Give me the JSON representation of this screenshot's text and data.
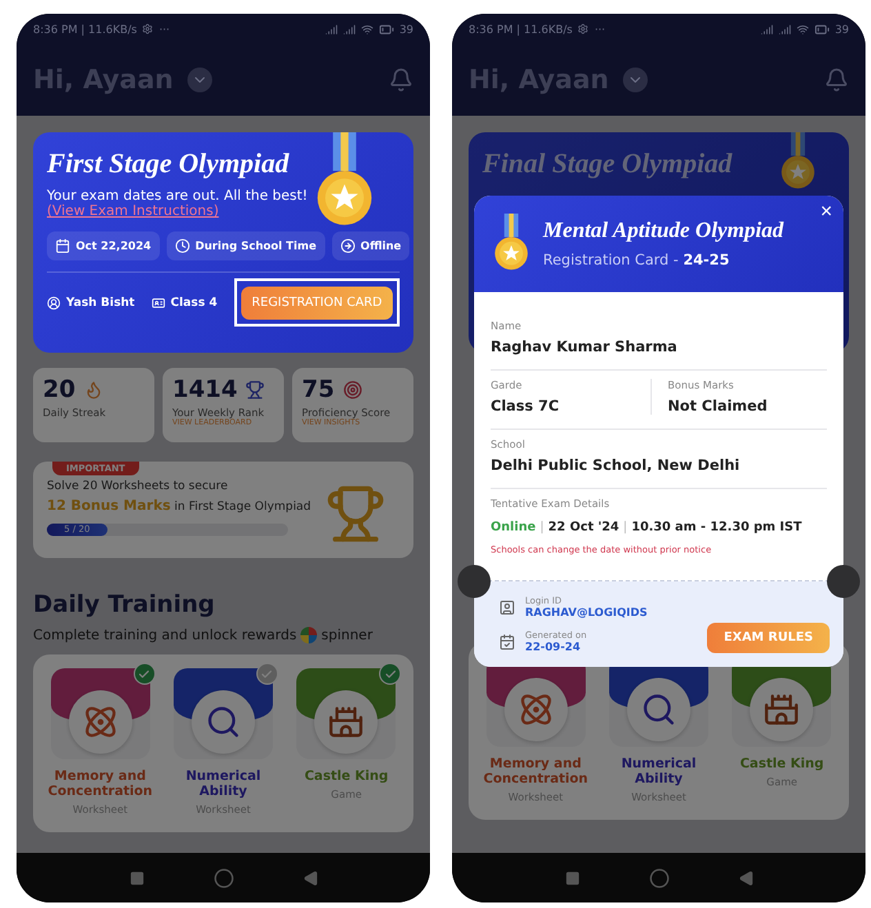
{
  "home_screen": {
    "status_bar": {
      "time": "8:36 PM | 11.6KB/s",
      "more": "···",
      "battery": "39"
    },
    "greeting": "Hi, Ayaan",
    "olympiad_card": {
      "title": "First Stage Olympiad",
      "message": "Your exam dates are out. All the best!",
      "link": "(View Exam Instructions)",
      "chips": [
        {
          "kind": "date",
          "label": "Oct 22,2024"
        },
        {
          "kind": "time",
          "label": "During School Time"
        },
        {
          "kind": "mode",
          "label": "Offline"
        }
      ],
      "student": "Yash Bisht",
      "class": "Class 4",
      "button": "REGISTRATION CARD",
      "highlighted": true
    },
    "stats": [
      {
        "kind": "streak",
        "value": "20",
        "label": "Daily Streak"
      },
      {
        "kind": "rank",
        "value": "1414",
        "label": "Your Weekly Rank",
        "link": "VIEW LEADERBOARD"
      },
      {
        "kind": "score",
        "value": "75",
        "label": "Proficiency Score",
        "link": "VIEW INSIGHTS"
      }
    ],
    "important": {
      "badge": "IMPORTANT",
      "line": "Solve 20 Worksheets to secure",
      "bonus": "12 Bonus Marks",
      "line_end": "in First Stage Olympiad",
      "level": 0.25,
      "progress": "5 / 20"
    },
    "daily_training": {
      "title": "Daily Training",
      "subtitle": "Complete training and unlock rewards",
      "reward": "spinner",
      "items": [
        {
          "kind": "atom",
          "title": "Memory and Concentration",
          "type": "Worksheet",
          "checked": true
        },
        {
          "kind": "chart",
          "title": "Numerical Ability",
          "type": "Worksheet",
          "checked": false
        },
        {
          "kind": "castle",
          "title": "Castle King",
          "type": "Game",
          "checked": true
        }
      ]
    }
  },
  "registration_screen": {
    "status_bar": {
      "time": "8:36 PM | 11.6KB/s",
      "more": "···",
      "battery": "39"
    },
    "greeting": "Hi, Ayaan",
    "background_card": {
      "title": "Final Stage Olympiad"
    },
    "training_items": [
      {
        "kind": "atom",
        "title": "Memory and Concentration",
        "type": "Worksheet"
      },
      {
        "kind": "chart",
        "title": "Numerical Ability",
        "type": "Worksheet"
      },
      {
        "kind": "castle",
        "title": "Castle King",
        "type": "Game"
      }
    ],
    "dialog": {
      "title": "Mental Aptitude Olympiad",
      "subtitle": "Registration Card - **24-25**",
      "close": "×",
      "name": {
        "label": "Name",
        "value": "Raghav Kumar Sharma"
      },
      "grade": {
        "label": "Garde",
        "value": "Class 7C"
      },
      "bonus": {
        "label": "Bonus Marks",
        "value": "Not Claimed"
      },
      "school": {
        "label": "School",
        "value": "Delhi Public School, New Delhi"
      },
      "exam": {
        "label": "Tentative Exam Details",
        "mode": "Online",
        "separator": "|",
        "date": "22 Oct '24",
        "time": "10.30 am - 12.30 pm IST",
        "note": "Schools can change the date without prior notice"
      },
      "login": {
        "label": "Login ID",
        "value": "RAGHAV@LOGIQIDS"
      },
      "generated": {
        "label": "Generated on",
        "value": "22-09-24"
      },
      "button": "EXAM RULES"
    }
  }
}
